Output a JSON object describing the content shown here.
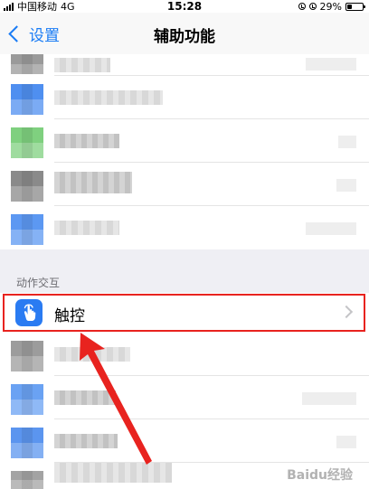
{
  "status_bar": {
    "carrier": "中国移动",
    "network": "4G",
    "time": "15:28",
    "battery_percent_label": "29%",
    "battery_level": 0.29
  },
  "nav": {
    "back_label": "设置",
    "title": "辅助功能"
  },
  "section": {
    "header": "动作交互",
    "touch_label": "触控"
  },
  "colors": {
    "accent": "#1a7cf5",
    "highlight": "#e8231f",
    "touch_icon": "#2a7bf2"
  },
  "icons": {
    "back": "chevron-left-icon",
    "touch": "hand-pointer-icon",
    "disclosure": "chevron-right-icon"
  },
  "watermark": "Baidu经验"
}
